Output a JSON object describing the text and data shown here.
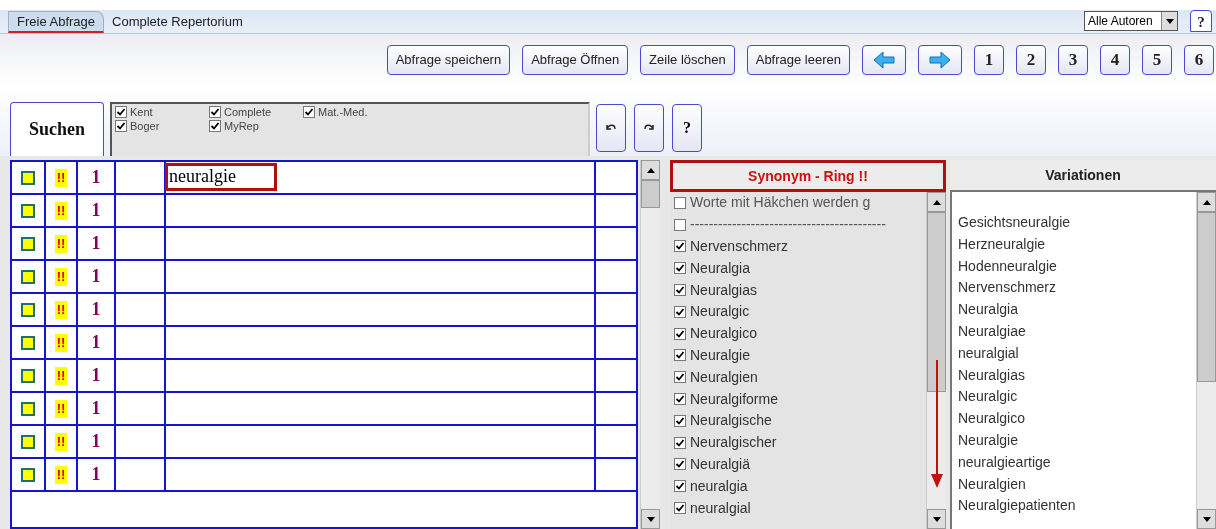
{
  "tabs": [
    {
      "label": "Freie Abfrage",
      "selected": true
    },
    {
      "label": "Complete Repertorium",
      "selected": false
    }
  ],
  "author_select": {
    "value": "Alle Autoren"
  },
  "help_button": "?",
  "toolbar": {
    "buttons": [
      {
        "kind": "text",
        "label": "Abfrage speichern"
      },
      {
        "kind": "text",
        "label": "Abfrage Öffnen"
      },
      {
        "kind": "text",
        "label": "Zeile löschen"
      },
      {
        "kind": "text",
        "label": "Abfrage leeren"
      },
      {
        "kind": "back"
      },
      {
        "kind": "forward"
      },
      {
        "kind": "number",
        "label": "1"
      },
      {
        "kind": "number",
        "label": "2"
      },
      {
        "kind": "number",
        "label": "3"
      },
      {
        "kind": "number",
        "label": "4"
      },
      {
        "kind": "number",
        "label": "5"
      },
      {
        "kind": "number",
        "label": "6"
      }
    ]
  },
  "search_tab": "Suchen",
  "sources": [
    {
      "label": "Kent",
      "checked": true
    },
    {
      "label": "Boger",
      "checked": true
    },
    {
      "label": "Complete",
      "checked": true
    },
    {
      "label": "MyRep",
      "checked": true
    },
    {
      "label": "Mat.-Med.",
      "checked": true
    }
  ],
  "search_tools": [
    {
      "kind": "undo"
    },
    {
      "kind": "redo"
    },
    {
      "kind": "help",
      "label": "?"
    }
  ],
  "query_rows": [
    {
      "checked": false,
      "flag": "!!",
      "weight": "1",
      "term": "neuralgie"
    },
    {
      "checked": false,
      "flag": "!!",
      "weight": "1"
    },
    {
      "checked": false,
      "flag": "!!",
      "weight": "1"
    },
    {
      "checked": false,
      "flag": "!!",
      "weight": "1"
    },
    {
      "checked": false,
      "flag": "!!",
      "weight": "1"
    },
    {
      "checked": false,
      "flag": "!!",
      "weight": "1"
    },
    {
      "checked": false,
      "flag": "!!",
      "weight": "1"
    },
    {
      "checked": false,
      "flag": "!!",
      "weight": "1"
    },
    {
      "checked": false,
      "flag": "!!",
      "weight": "1"
    },
    {
      "checked": false,
      "flag": "!!",
      "weight": "1"
    }
  ],
  "synonym_ring": {
    "title": "Synonym - Ring !!",
    "items": [
      {
        "label": "Worte mit Häkchen werden g",
        "checked": false
      },
      {
        "label": "------------------------------------------",
        "checked": false
      },
      {
        "label": "Nervenschmerz",
        "checked": true
      },
      {
        "label": "Neuralgia",
        "checked": true
      },
      {
        "label": "Neuralgias",
        "checked": true
      },
      {
        "label": "Neuralgic",
        "checked": true
      },
      {
        "label": "Neuralgico",
        "checked": true
      },
      {
        "label": "Neuralgie",
        "checked": true
      },
      {
        "label": "Neuralgien",
        "checked": true
      },
      {
        "label": "Neuralgiforme",
        "checked": true
      },
      {
        "label": "Neuralgische",
        "checked": true
      },
      {
        "label": "Neuralgischer",
        "checked": true
      },
      {
        "label": "Neuralgiä",
        "checked": true
      },
      {
        "label": "neuralgia",
        "checked": true
      },
      {
        "label": "neuralgial",
        "checked": true
      }
    ]
  },
  "variations": {
    "title": "Variationen",
    "items": [
      "Gesichtsneuralgie",
      "Herzneuralgie",
      "Hodenneuralgie",
      "Nervenschmerz",
      "Neuralgia",
      "Neuralgiae",
      "neuralgial",
      "Neuralgias",
      "Neuralgic",
      "Neuralgico",
      "Neuralgie",
      "neuralgieartige",
      "Neuralgien",
      "Neuralgiepatienten"
    ]
  }
}
